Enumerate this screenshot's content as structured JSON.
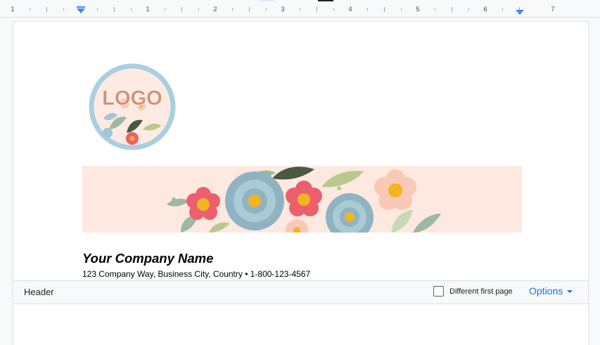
{
  "ruler": {
    "numbers": [
      "1",
      "1",
      "2",
      "3",
      "4",
      "5",
      "6",
      "7"
    ],
    "marker_color": "#4285f4"
  },
  "document": {
    "logo_text": "LOGO",
    "company_name": "Your Company Name",
    "company_address": "123 Company Way, Business City, Country • 1-800-123-4567"
  },
  "header_bar": {
    "label": "Header",
    "different_first_page_label": "Different first page",
    "different_first_page_checked": false,
    "options_label": "Options"
  },
  "colors": {
    "accent": "#1a73e8",
    "banner_bg": "#fde9e0",
    "logo_ring": "#a9cfe0"
  }
}
